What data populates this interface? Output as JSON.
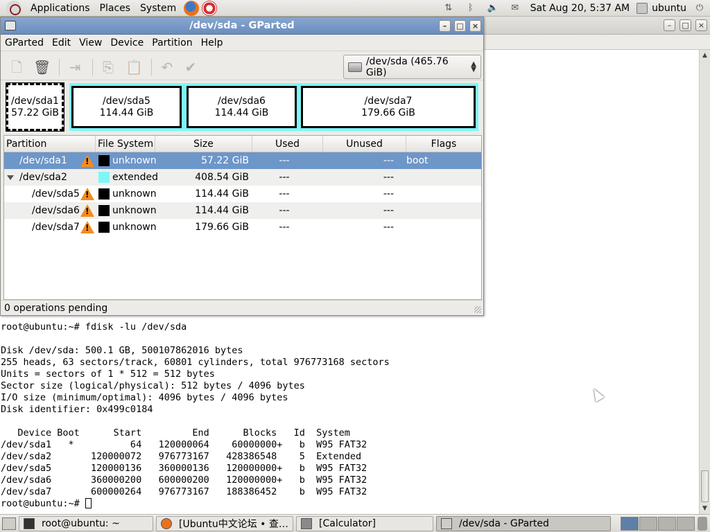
{
  "top_panel": {
    "menus": [
      "Applications",
      "Places",
      "System"
    ],
    "clock": "Sat Aug 20,  5:37 AM",
    "user": "ubuntu",
    "icons": [
      "ubuntu-logo-icon",
      "firefox-icon",
      "help-icon",
      "network-icon",
      "bluetooth-icon",
      "volume-icon",
      "mail-icon",
      "power-icon"
    ]
  },
  "gparted": {
    "title": "/dev/sda - GParted",
    "menu": [
      "GParted",
      "Edit",
      "View",
      "Device",
      "Partition",
      "Help"
    ],
    "device_selector": "/dev/sda  (465.76 GiB)",
    "disk_map": [
      {
        "name": "/dev/sda1",
        "size": "57.22 GiB"
      },
      {
        "name": "/dev/sda5",
        "size": "114.44 GiB"
      },
      {
        "name": "/dev/sda6",
        "size": "114.44 GiB"
      },
      {
        "name": "/dev/sda7",
        "size": "179.66 GiB"
      }
    ],
    "table": {
      "columns": [
        "Partition",
        "File System",
        "Size",
        "Used",
        "Unused",
        "Flags"
      ],
      "rows": [
        {
          "partition": "/dev/sda1",
          "fs": "unknown",
          "size": "57.22 GiB",
          "used": "---",
          "unused": "---",
          "flags": "boot",
          "fs_color": "#000000"
        },
        {
          "partition": "/dev/sda2",
          "fs": "extended",
          "size": "408.54 GiB",
          "used": "---",
          "unused": "---",
          "flags": "",
          "fs_color": "#7ff6f6"
        },
        {
          "partition": "/dev/sda5",
          "fs": "unknown",
          "size": "114.44 GiB",
          "used": "---",
          "unused": "---",
          "flags": "",
          "fs_color": "#000000"
        },
        {
          "partition": "/dev/sda6",
          "fs": "unknown",
          "size": "114.44 GiB",
          "used": "---",
          "unused": "---",
          "flags": "",
          "fs_color": "#000000"
        },
        {
          "partition": "/dev/sda7",
          "fs": "unknown",
          "size": "179.66 GiB",
          "used": "---",
          "unused": "---",
          "flags": "",
          "fs_color": "#000000"
        }
      ]
    },
    "status": "0 operations pending"
  },
  "terminal": {
    "lines": [
      "root@ubuntu:~# fdisk -lu /dev/sda",
      "",
      "Disk /dev/sda: 500.1 GB, 500107862016 bytes",
      "255 heads, 63 sectors/track, 60801 cylinders, total 976773168 sectors",
      "Units = sectors of 1 * 512 = 512 bytes",
      "Sector size (logical/physical): 512 bytes / 4096 bytes",
      "I/O size (minimum/optimal): 4096 bytes / 4096 bytes",
      "Disk identifier: 0x499c0184",
      "",
      "   Device Boot      Start         End      Blocks   Id  System",
      "/dev/sda1   *          64   120000064    60000000+   b  W95 FAT32",
      "/dev/sda2       120000072   976773167   428386548    5  Extended",
      "/dev/sda5       120000136   360000136   120000000+   b  W95 FAT32",
      "/dev/sda6       360000200   600000200   120000000+   b  W95 FAT32",
      "/dev/sda7       600000264   976773167   188386452    b  W95 FAT32"
    ],
    "prompt": "root@ubuntu:~# "
  },
  "taskbar": {
    "tasks": [
      {
        "label": "root@ubuntu: ~",
        "icon": "terminal-icon",
        "active": false
      },
      {
        "label": "[Ubuntu中文论坛 • 查…",
        "icon": "firefox-icon",
        "active": false
      },
      {
        "label": "[Calculator]",
        "icon": "calculator-icon",
        "active": false
      },
      {
        "label": "/dev/sda - GParted",
        "icon": "gparted-icon",
        "active": true
      }
    ]
  }
}
